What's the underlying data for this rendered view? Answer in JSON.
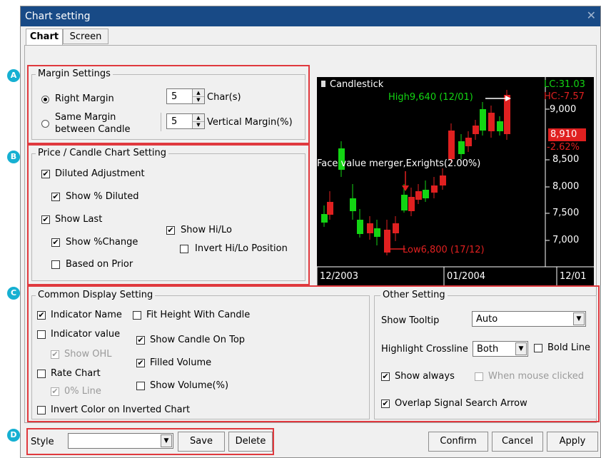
{
  "dialog": {
    "title": "Chart setting"
  },
  "tabs": [
    {
      "label": "Chart"
    },
    {
      "label": "Screen"
    }
  ],
  "badges": [
    "A",
    "B",
    "C",
    "D"
  ],
  "margin": {
    "title": "Margin Settings",
    "right_margin_label": "Right Margin",
    "right_margin_value": "5",
    "right_margin_unit": "Char(s)",
    "same_margin_label_1": "Same Margin",
    "same_margin_label_2": "between Candle",
    "vertical_margin_value": "5",
    "vertical_margin_unit": "Vertical Margin(%)"
  },
  "price": {
    "title": "Price / Candle Chart Setting",
    "diluted_adjustment": "Diluted Adjustment",
    "show_pct_diluted": "Show % Diluted",
    "show_last": "Show Last",
    "show_pct_change": "Show %Change",
    "based_on_prior": "Based on Prior",
    "show_hilo": "Show Hi/Lo",
    "invert_hilo": "Invert Hi/Lo Position"
  },
  "chart": {
    "title": "Candlestick",
    "high_label": "High9,640 (12/01)",
    "low_label": "Low6,800 (17/12)",
    "event_label": "Face value merger,Exrights(2.00%)",
    "lc": "LC:31.03",
    "hc": "HC:-7.57",
    "price_box": "8,910",
    "pct_box": "-2.62%",
    "y_ticks": [
      "9,000",
      "8,500",
      "8,000",
      "7,500",
      "7,000"
    ],
    "x_ticks": [
      "12/2003",
      "01/2004",
      "12/01"
    ],
    "colors": {
      "up": "#e02020",
      "down": "#13d513",
      "text": "#ffffff",
      "lc": "#13d513",
      "hc": "#e02020"
    }
  },
  "common": {
    "title": "Common Display Setting",
    "indicator_name": "Indicator Name",
    "fit_height": "Fit Height With Candle",
    "indicator_value": "Indicator value",
    "show_candle_top": "Show Candle On Top",
    "show_ohl": "Show OHL",
    "filled_volume": "Filled Volume",
    "rate_chart": "Rate Chart",
    "show_volume_pct": "Show Volume(%)",
    "zero_line": "0% Line",
    "invert_color": "Invert Color on Inverted Chart"
  },
  "other": {
    "title": "Other Setting",
    "show_tooltip": "Show Tooltip",
    "tooltip_value": "Auto",
    "highlight_crossline": "Highlight Crossline",
    "crossline_value": "Both",
    "bold_line": "Bold Line",
    "show_always": "Show always",
    "when_mouse_clicked": "When mouse clicked",
    "overlap_signal": "Overlap Signal Search Arrow"
  },
  "footer": {
    "style_label": "Style",
    "style_value": "",
    "save": "Save",
    "delete": "Delete",
    "confirm": "Confirm",
    "cancel": "Cancel",
    "apply": "Apply"
  },
  "checkmark": "✔"
}
